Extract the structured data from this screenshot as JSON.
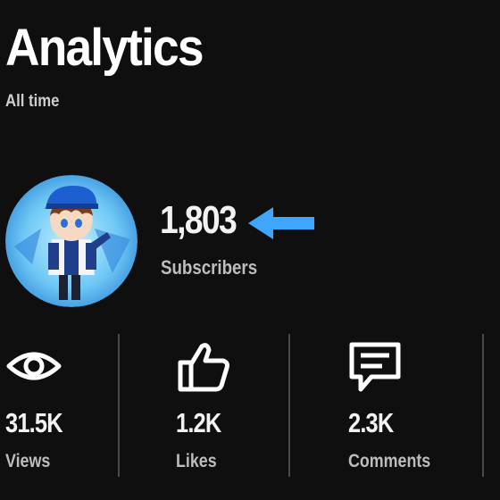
{
  "page": {
    "title": "Analytics",
    "subtitle": "All time"
  },
  "channel": {
    "avatar_icon": "channel-avatar-character",
    "subscribers_value": "1,803",
    "subscribers_label": "Subscribers",
    "callout_icon": "left-arrow-icon",
    "callout_color": "#3ea6ff"
  },
  "stats": [
    {
      "icon": "eye-icon",
      "value": "31.5K",
      "label": "Views"
    },
    {
      "icon": "thumbs-up-icon",
      "value": "1.2K",
      "label": "Likes"
    },
    {
      "icon": "comment-icon",
      "value": "2.3K",
      "label": "Comments"
    }
  ]
}
